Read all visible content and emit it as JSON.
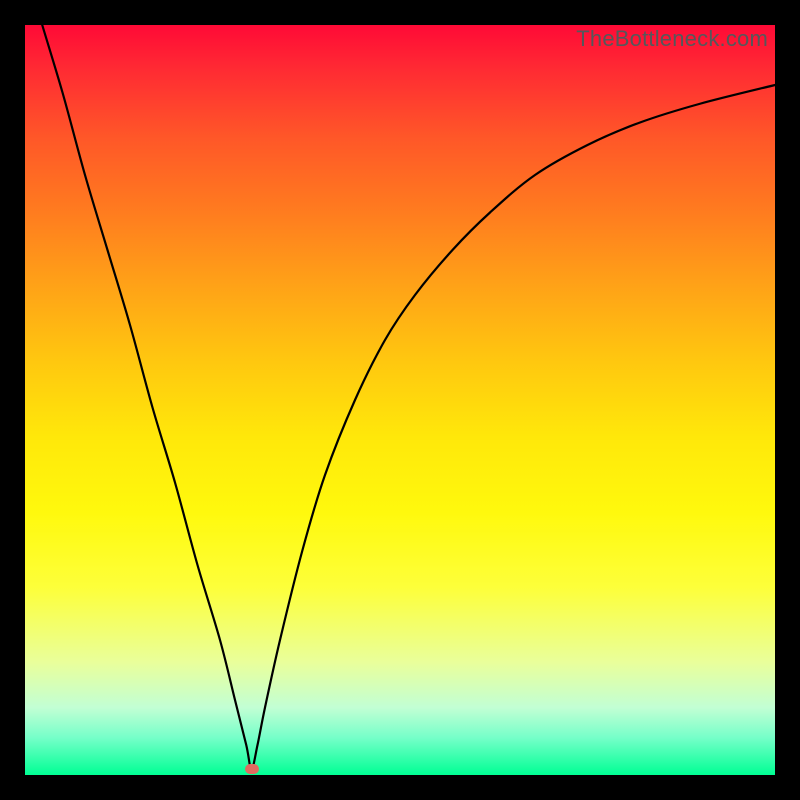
{
  "watermark": "TheBottleneck.com",
  "chart_data": {
    "type": "line",
    "title": "",
    "xlabel": "",
    "ylabel": "",
    "xlim": [
      0,
      100
    ],
    "ylim": [
      0,
      100
    ],
    "grid": false,
    "series": [
      {
        "name": "bottleneck-curve",
        "x": [
          0,
          2,
          5,
          8,
          11,
          14,
          17,
          20,
          23,
          26,
          28,
          29.5,
          30.2,
          31,
          32,
          34,
          37,
          40,
          44,
          48,
          52,
          57,
          62,
          68,
          75,
          82,
          90,
          100
        ],
        "y": [
          108,
          101,
          91,
          80,
          70,
          60,
          49,
          39,
          28,
          18,
          10,
          4,
          0.8,
          4,
          9,
          18,
          30,
          40,
          50,
          58,
          64,
          70,
          75,
          80,
          84,
          87,
          89.5,
          92
        ]
      }
    ],
    "marker": {
      "x": 30.2,
      "y": 0.8,
      "color": "#e06a60"
    }
  },
  "colors": {
    "background_top": "#ff0a36",
    "background_bottom": "#00ff94",
    "curve": "#000000",
    "frame": "#000000"
  }
}
